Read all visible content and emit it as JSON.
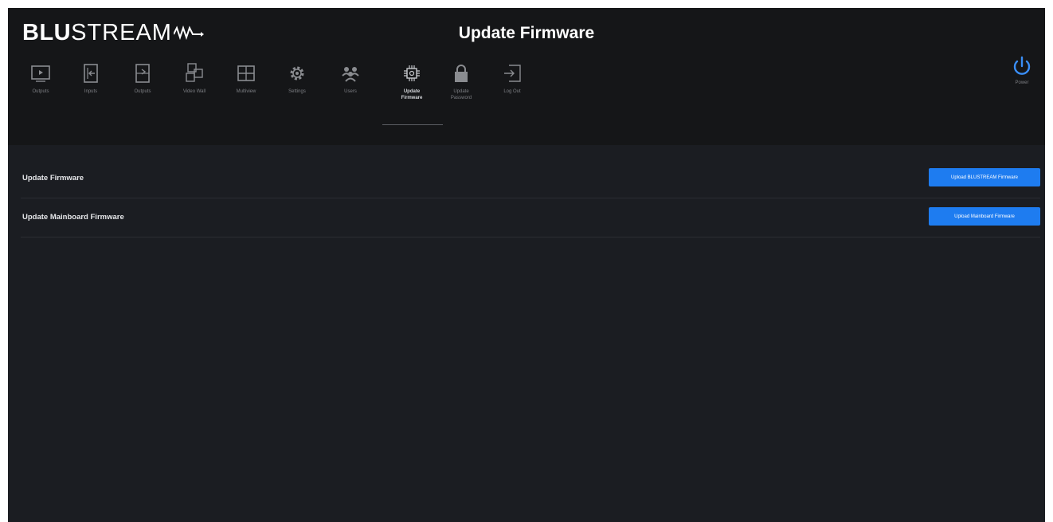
{
  "brand": {
    "logo_bold": "BLU",
    "logo_thin": "STREAM"
  },
  "page_title": "Update Firmware",
  "nav": {
    "items": [
      {
        "label": "Outputs",
        "icon": "tv-icon"
      },
      {
        "label": "Inputs",
        "icon": "input-icon"
      },
      {
        "label": "Outputs",
        "icon": "output-icon"
      },
      {
        "label": "Video Wall",
        "icon": "video-wall-icon"
      },
      {
        "label": "Multiview",
        "icon": "multiview-icon"
      },
      {
        "label": "Settings",
        "icon": "gear-icon"
      },
      {
        "label": "Users",
        "icon": "users-icon"
      },
      {
        "label": "Update\nFirmware",
        "icon": "firmware-chip-icon",
        "active": true
      },
      {
        "label": "Update\nPassword",
        "icon": "lock-icon"
      },
      {
        "label": "Log Out",
        "icon": "logout-icon"
      }
    ],
    "power_label": "Power"
  },
  "rows": [
    {
      "label": "Update Firmware",
      "button": "Upload BLUSTREAM Firmware"
    },
    {
      "label": "Update Mainboard Firmware",
      "button": "Upload Mainboard Firmware"
    }
  ],
  "colors": {
    "background": "#1b1d22",
    "header": "#151618",
    "accent": "#1e7cf0",
    "power_icon": "#3a8ef6"
  }
}
